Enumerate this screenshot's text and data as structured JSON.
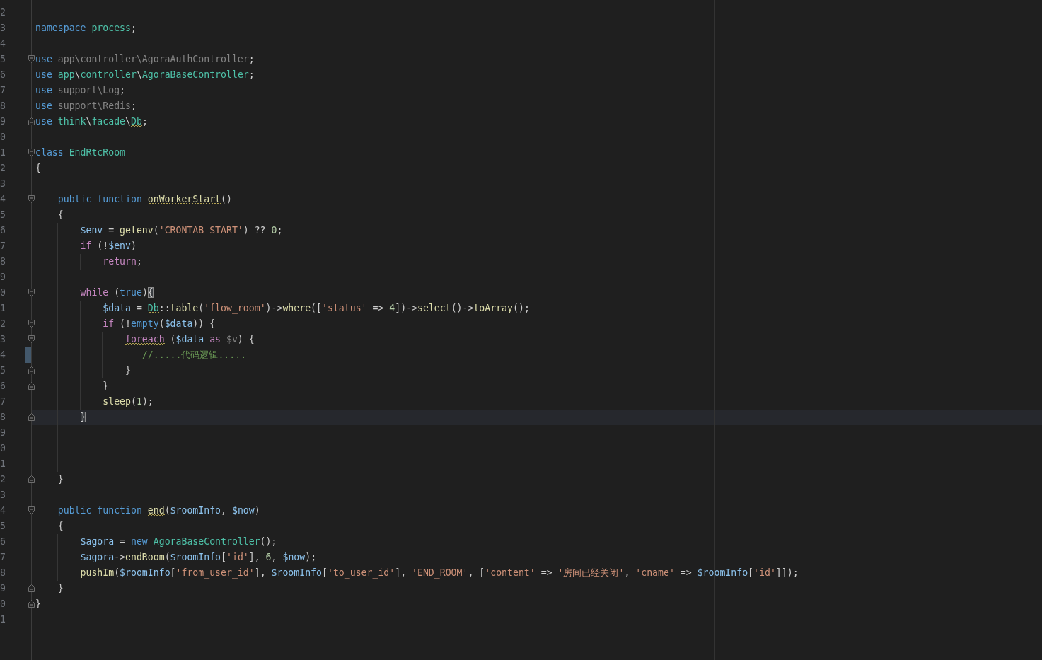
{
  "editor": {
    "lines": [
      {
        "number": "2",
        "current": false,
        "changed": false,
        "fold_start": false,
        "fold_end": false
      },
      {
        "number": "3",
        "current": false,
        "changed": false,
        "fold_start": false,
        "fold_end": false,
        "tokens": [
          {
            "text": "namespace ",
            "kind": "keyword",
            "warning": false,
            "matched": false
          },
          {
            "text": "process",
            "kind": "class",
            "warning": false,
            "matched": false
          },
          {
            "text": ";",
            "kind": "plain",
            "warning": false,
            "matched": false
          }
        ]
      },
      {
        "number": "4",
        "current": false,
        "changed": false,
        "fold_start": false,
        "fold_end": false
      },
      {
        "number": "5",
        "current": false,
        "changed": false,
        "fold_start": true,
        "fold_end": false,
        "tokens": [
          {
            "text": "use ",
            "kind": "keyword",
            "warning": false,
            "matched": false
          },
          {
            "text": "app\\controller\\AgoraAuthController",
            "kind": "unused",
            "warning": false,
            "matched": false
          },
          {
            "text": ";",
            "kind": "plain",
            "warning": false,
            "matched": false
          }
        ]
      },
      {
        "number": "6",
        "current": false,
        "changed": false,
        "fold_start": false,
        "fold_end": false,
        "tokens": [
          {
            "text": "use ",
            "kind": "keyword",
            "warning": false,
            "matched": false
          },
          {
            "text": "app",
            "kind": "class",
            "warning": false,
            "matched": false
          },
          {
            "text": "\\",
            "kind": "plain",
            "warning": false,
            "matched": false
          },
          {
            "text": "controller",
            "kind": "class",
            "warning": false,
            "matched": false
          },
          {
            "text": "\\",
            "kind": "plain",
            "warning": false,
            "matched": false
          },
          {
            "text": "AgoraBaseController",
            "kind": "class",
            "warning": false,
            "matched": false
          },
          {
            "text": ";",
            "kind": "plain",
            "warning": false,
            "matched": false
          }
        ]
      },
      {
        "number": "7",
        "current": false,
        "changed": false,
        "fold_start": false,
        "fold_end": false,
        "tokens": [
          {
            "text": "use ",
            "kind": "keyword",
            "warning": false,
            "matched": false
          },
          {
            "text": "support\\Log",
            "kind": "unused",
            "warning": false,
            "matched": false
          },
          {
            "text": ";",
            "kind": "plain",
            "warning": false,
            "matched": false
          }
        ]
      },
      {
        "number": "8",
        "current": false,
        "changed": false,
        "fold_start": false,
        "fold_end": false,
        "tokens": [
          {
            "text": "use ",
            "kind": "keyword",
            "warning": false,
            "matched": false
          },
          {
            "text": "support\\Redis",
            "kind": "unused",
            "warning": false,
            "matched": false
          },
          {
            "text": ";",
            "kind": "plain",
            "warning": false,
            "matched": false
          }
        ]
      },
      {
        "number": "9",
        "current": false,
        "changed": false,
        "fold_start": false,
        "fold_end": true,
        "tokens": [
          {
            "text": "use ",
            "kind": "keyword",
            "warning": false,
            "matched": false
          },
          {
            "text": "think",
            "kind": "class",
            "warning": false,
            "matched": false
          },
          {
            "text": "\\",
            "kind": "plain",
            "warning": false,
            "matched": false
          },
          {
            "text": "facade",
            "kind": "class",
            "warning": false,
            "matched": false
          },
          {
            "text": "\\",
            "kind": "plain",
            "warning": false,
            "matched": false
          },
          {
            "text": "Db",
            "kind": "class",
            "warning": true,
            "matched": false
          },
          {
            "text": ";",
            "kind": "plain",
            "warning": false,
            "matched": false
          }
        ]
      },
      {
        "number": "0",
        "current": false,
        "changed": false,
        "fold_start": false,
        "fold_end": false
      },
      {
        "number": "1",
        "current": false,
        "changed": false,
        "fold_start": true,
        "fold_end": false,
        "tokens": [
          {
            "text": "class ",
            "kind": "keyword",
            "warning": false,
            "matched": false
          },
          {
            "text": "EndRtcRoom",
            "kind": "class",
            "warning": false,
            "matched": false
          }
        ]
      },
      {
        "number": "2",
        "current": false,
        "changed": false,
        "fold_start": false,
        "fold_end": false,
        "tokens": [
          {
            "text": "{",
            "kind": "plain",
            "warning": false,
            "matched": false
          }
        ],
        "children": [
          {
            "number": "3",
            "current": false,
            "changed": false,
            "fold_start": false,
            "fold_end": false
          },
          {
            "number": "4",
            "current": false,
            "changed": false,
            "fold_start": true,
            "fold_end": false,
            "tokens": [
              {
                "text": "public function ",
                "kind": "keyword",
                "warning": false,
                "matched": false
              },
              {
                "text": "onWorkerStart",
                "kind": "function",
                "warning": true,
                "matched": false
              },
              {
                "text": "()",
                "kind": "plain",
                "warning": false,
                "matched": false
              }
            ]
          },
          {
            "number": "5",
            "current": false,
            "changed": false,
            "fold_start": false,
            "fold_end": false,
            "tokens": [
              {
                "text": "{",
                "kind": "plain",
                "warning": false,
                "matched": false
              }
            ],
            "children": [
              {
                "number": "6",
                "current": false,
                "changed": false,
                "fold_start": false,
                "fold_end": false,
                "tokens": [
                  {
                    "text": "$env",
                    "kind": "variable",
                    "warning": false,
                    "matched": false
                  },
                  {
                    "text": " = ",
                    "kind": "plain",
                    "warning": false,
                    "matched": false
                  },
                  {
                    "text": "getenv",
                    "kind": "function",
                    "warning": false,
                    "matched": false
                  },
                  {
                    "text": "(",
                    "kind": "plain",
                    "warning": false,
                    "matched": false
                  },
                  {
                    "text": "'CRONTAB_START'",
                    "kind": "string",
                    "warning": false,
                    "matched": false
                  },
                  {
                    "text": ") ?? ",
                    "kind": "plain",
                    "warning": false,
                    "matched": false
                  },
                  {
                    "text": "0",
                    "kind": "number",
                    "warning": false,
                    "matched": false
                  },
                  {
                    "text": ";",
                    "kind": "plain",
                    "warning": false,
                    "matched": false
                  }
                ]
              },
              {
                "number": "7",
                "current": false,
                "changed": false,
                "fold_start": false,
                "fold_end": false,
                "tokens": [
                  {
                    "text": "if",
                    "kind": "control",
                    "warning": false,
                    "matched": false
                  },
                  {
                    "text": " (!",
                    "kind": "plain",
                    "warning": false,
                    "matched": false
                  },
                  {
                    "text": "$env",
                    "kind": "variable",
                    "warning": false,
                    "matched": false
                  },
                  {
                    "text": ")",
                    "kind": "plain",
                    "warning": false,
                    "matched": false
                  }
                ],
                "children": [
                  {
                    "number": "8",
                    "current": false,
                    "changed": false,
                    "fold_start": false,
                    "fold_end": false,
                    "tokens": [
                      {
                        "text": "return",
                        "kind": "control",
                        "warning": false,
                        "matched": false
                      },
                      {
                        "text": ";",
                        "kind": "plain",
                        "warning": false,
                        "matched": false
                      }
                    ]
                  }
                ]
              },
              {
                "number": "9",
                "current": false,
                "changed": false,
                "fold_start": false,
                "fold_end": false
              },
              {
                "number": "0",
                "current": false,
                "changed": false,
                "fold_start": true,
                "fold_end": false,
                "tokens": [
                  {
                    "text": "while",
                    "kind": "control",
                    "warning": false,
                    "matched": false
                  },
                  {
                    "text": " (",
                    "kind": "plain",
                    "warning": false,
                    "matched": false
                  },
                  {
                    "text": "true",
                    "kind": "keyword",
                    "warning": false,
                    "matched": false
                  },
                  {
                    "text": ")",
                    "kind": "plain",
                    "warning": false,
                    "matched": false
                  },
                  {
                    "text": "{",
                    "kind": "plain",
                    "warning": false,
                    "matched": true
                  }
                ],
                "children": [
                  {
                    "number": "1",
                    "current": false,
                    "changed": false,
                    "fold_start": false,
                    "fold_end": false,
                    "tokens": [
                      {
                        "text": "$data",
                        "kind": "variable",
                        "warning": false,
                        "matched": false
                      },
                      {
                        "text": " = ",
                        "kind": "plain",
                        "warning": false,
                        "matched": false
                      },
                      {
                        "text": "Db",
                        "kind": "class",
                        "warning": true,
                        "matched": false
                      },
                      {
                        "text": "::",
                        "kind": "plain",
                        "warning": false,
                        "matched": false
                      },
                      {
                        "text": "table",
                        "kind": "function",
                        "warning": false,
                        "matched": false
                      },
                      {
                        "text": "(",
                        "kind": "plain",
                        "warning": false,
                        "matched": false
                      },
                      {
                        "text": "'flow_room'",
                        "kind": "string",
                        "warning": false,
                        "matched": false
                      },
                      {
                        "text": ")->",
                        "kind": "plain",
                        "warning": false,
                        "matched": false
                      },
                      {
                        "text": "where",
                        "kind": "function",
                        "warning": false,
                        "matched": false
                      },
                      {
                        "text": "([",
                        "kind": "plain",
                        "warning": false,
                        "matched": false
                      },
                      {
                        "text": "'status'",
                        "kind": "string",
                        "warning": false,
                        "matched": false
                      },
                      {
                        "text": " => ",
                        "kind": "plain",
                        "warning": false,
                        "matched": false
                      },
                      {
                        "text": "4",
                        "kind": "number",
                        "warning": false,
                        "matched": false
                      },
                      {
                        "text": "])->",
                        "kind": "plain",
                        "warning": false,
                        "matched": false
                      },
                      {
                        "text": "select",
                        "kind": "function",
                        "warning": false,
                        "matched": false
                      },
                      {
                        "text": "()->",
                        "kind": "plain",
                        "warning": false,
                        "matched": false
                      },
                      {
                        "text": "toArray",
                        "kind": "function",
                        "warning": false,
                        "matched": false
                      },
                      {
                        "text": "();",
                        "kind": "plain",
                        "warning": false,
                        "matched": false
                      }
                    ]
                  },
                  {
                    "number": "2",
                    "current": false,
                    "changed": false,
                    "fold_start": true,
                    "fold_end": false,
                    "tokens": [
                      {
                        "text": "if",
                        "kind": "control",
                        "warning": false,
                        "matched": false
                      },
                      {
                        "text": " (!",
                        "kind": "plain",
                        "warning": false,
                        "matched": false
                      },
                      {
                        "text": "empty",
                        "kind": "keyword",
                        "warning": false,
                        "matched": false
                      },
                      {
                        "text": "(",
                        "kind": "plain",
                        "warning": false,
                        "matched": false
                      },
                      {
                        "text": "$data",
                        "kind": "variable",
                        "warning": false,
                        "matched": false
                      },
                      {
                        "text": ")) {",
                        "kind": "plain",
                        "warning": false,
                        "matched": false
                      }
                    ],
                    "children": [
                      {
                        "number": "3",
                        "current": false,
                        "changed": false,
                        "fold_start": true,
                        "fold_end": false,
                        "tokens": [
                          {
                            "text": "foreach",
                            "kind": "control",
                            "warning": true,
                            "matched": false
                          },
                          {
                            "text": " (",
                            "kind": "plain",
                            "warning": false,
                            "matched": false
                          },
                          {
                            "text": "$data",
                            "kind": "variable",
                            "warning": false,
                            "matched": false
                          },
                          {
                            "text": " as ",
                            "kind": "control",
                            "warning": false,
                            "matched": false
                          },
                          {
                            "text": "$v",
                            "kind": "unused",
                            "warning": false,
                            "matched": false
                          },
                          {
                            "text": ") {",
                            "kind": "plain",
                            "warning": false,
                            "matched": false
                          }
                        ]
                      },
                      {
                        "number": "4",
                        "current": false,
                        "changed": true,
                        "fold_start": false,
                        "fold_end": false,
                        "tokens": [
                          {
                            "text": "   //.....代码逻辑.....",
                            "kind": "comment",
                            "warning": false,
                            "matched": false
                          }
                        ]
                      },
                      {
                        "number": "5",
                        "current": false,
                        "changed": false,
                        "fold_start": false,
                        "fold_end": true,
                        "tokens": [
                          {
                            "text": "}",
                            "kind": "plain",
                            "warning": false,
                            "matched": false
                          }
                        ]
                      }
                    ]
                  },
                  {
                    "number": "6",
                    "current": false,
                    "changed": false,
                    "fold_start": false,
                    "fold_end": true,
                    "tokens": [
                      {
                        "text": "}",
                        "kind": "plain",
                        "warning": false,
                        "matched": false
                      }
                    ]
                  },
                  {
                    "number": "7",
                    "current": false,
                    "changed": false,
                    "fold_start": false,
                    "fold_end": false,
                    "tokens": [
                      {
                        "text": "sleep",
                        "kind": "function",
                        "warning": false,
                        "matched": false
                      },
                      {
                        "text": "(",
                        "kind": "plain",
                        "warning": false,
                        "matched": false
                      },
                      {
                        "text": "1",
                        "kind": "number",
                        "warning": false,
                        "matched": false
                      },
                      {
                        "text": ");",
                        "kind": "plain",
                        "warning": false,
                        "matched": false
                      }
                    ]
                  }
                ]
              },
              {
                "number": "8",
                "current": true,
                "changed": false,
                "fold_start": false,
                "fold_end": true,
                "tokens": [
                  {
                    "text": "}",
                    "kind": "plain",
                    "warning": false,
                    "matched": true
                  }
                ]
              },
              {
                "number": "9",
                "current": false,
                "changed": false,
                "fold_start": false,
                "fold_end": false
              },
              {
                "number": "0",
                "current": false,
                "changed": false,
                "fold_start": false,
                "fold_end": false
              },
              {
                "number": "1",
                "current": false,
                "changed": false,
                "fold_start": false,
                "fold_end": false
              }
            ]
          },
          {
            "number": "2",
            "current": false,
            "changed": false,
            "fold_start": false,
            "fold_end": true,
            "tokens": [
              {
                "text": "}",
                "kind": "plain",
                "warning": false,
                "matched": false
              }
            ]
          },
          {
            "number": "3",
            "current": false,
            "changed": false,
            "fold_start": false,
            "fold_end": false
          },
          {
            "number": "4",
            "current": false,
            "changed": false,
            "fold_start": true,
            "fold_end": false,
            "tokens": [
              {
                "text": "public function ",
                "kind": "keyword",
                "warning": false,
                "matched": false
              },
              {
                "text": "end",
                "kind": "function",
                "warning": true,
                "matched": false
              },
              {
                "text": "(",
                "kind": "plain",
                "warning": false,
                "matched": false
              },
              {
                "text": "$roomInfo",
                "kind": "variable",
                "warning": false,
                "matched": false
              },
              {
                "text": ", ",
                "kind": "plain",
                "warning": false,
                "matched": false
              },
              {
                "text": "$now",
                "kind": "variable",
                "warning": false,
                "matched": false
              },
              {
                "text": ")",
                "kind": "plain",
                "warning": false,
                "matched": false
              }
            ]
          },
          {
            "number": "5",
            "current": false,
            "changed": false,
            "fold_start": false,
            "fold_end": false,
            "tokens": [
              {
                "text": "{",
                "kind": "plain",
                "warning": false,
                "matched": false
              }
            ],
            "children": [
              {
                "number": "6",
                "current": false,
                "changed": false,
                "fold_start": false,
                "fold_end": false,
                "tokens": [
                  {
                    "text": "$agora",
                    "kind": "variable",
                    "warning": false,
                    "matched": false
                  },
                  {
                    "text": " = ",
                    "kind": "plain",
                    "warning": false,
                    "matched": false
                  },
                  {
                    "text": "new ",
                    "kind": "keyword",
                    "warning": false,
                    "matched": false
                  },
                  {
                    "text": "AgoraBaseController",
                    "kind": "class",
                    "warning": false,
                    "matched": false
                  },
                  {
                    "text": "();",
                    "kind": "plain",
                    "warning": false,
                    "matched": false
                  }
                ]
              },
              {
                "number": "7",
                "current": false,
                "changed": false,
                "fold_start": false,
                "fold_end": false,
                "tokens": [
                  {
                    "text": "$agora",
                    "kind": "variable",
                    "warning": false,
                    "matched": false
                  },
                  {
                    "text": "->",
                    "kind": "plain",
                    "warning": false,
                    "matched": false
                  },
                  {
                    "text": "endRoom",
                    "kind": "function",
                    "warning": false,
                    "matched": false
                  },
                  {
                    "text": "(",
                    "kind": "plain",
                    "warning": false,
                    "matched": false
                  },
                  {
                    "text": "$roomInfo",
                    "kind": "variable",
                    "warning": false,
                    "matched": false
                  },
                  {
                    "text": "[",
                    "kind": "plain",
                    "warning": false,
                    "matched": false
                  },
                  {
                    "text": "'id'",
                    "kind": "string",
                    "warning": false,
                    "matched": false
                  },
                  {
                    "text": "], ",
                    "kind": "plain",
                    "warning": false,
                    "matched": false
                  },
                  {
                    "text": "6",
                    "kind": "number",
                    "warning": false,
                    "matched": false
                  },
                  {
                    "text": ", ",
                    "kind": "plain",
                    "warning": false,
                    "matched": false
                  },
                  {
                    "text": "$now",
                    "kind": "variable",
                    "warning": false,
                    "matched": false
                  },
                  {
                    "text": ");",
                    "kind": "plain",
                    "warning": false,
                    "matched": false
                  }
                ]
              },
              {
                "number": "8",
                "current": false,
                "changed": false,
                "fold_start": false,
                "fold_end": false,
                "tokens": [
                  {
                    "text": "pushIm",
                    "kind": "function",
                    "warning": false,
                    "matched": false
                  },
                  {
                    "text": "(",
                    "kind": "plain",
                    "warning": false,
                    "matched": false
                  },
                  {
                    "text": "$roomInfo",
                    "kind": "variable",
                    "warning": false,
                    "matched": false
                  },
                  {
                    "text": "[",
                    "kind": "plain",
                    "warning": false,
                    "matched": false
                  },
                  {
                    "text": "'from_user_id'",
                    "kind": "string",
                    "warning": false,
                    "matched": false
                  },
                  {
                    "text": "], ",
                    "kind": "plain",
                    "warning": false,
                    "matched": false
                  },
                  {
                    "text": "$roomInfo",
                    "kind": "variable",
                    "warning": false,
                    "matched": false
                  },
                  {
                    "text": "[",
                    "kind": "plain",
                    "warning": false,
                    "matched": false
                  },
                  {
                    "text": "'to_user_id'",
                    "kind": "string",
                    "warning": false,
                    "matched": false
                  },
                  {
                    "text": "], ",
                    "kind": "plain",
                    "warning": false,
                    "matched": false
                  },
                  {
                    "text": "'END_ROOM'",
                    "kind": "string",
                    "warning": false,
                    "matched": false
                  },
                  {
                    "text": ", [",
                    "kind": "plain",
                    "warning": false,
                    "matched": false
                  },
                  {
                    "text": "'content'",
                    "kind": "string",
                    "warning": false,
                    "matched": false
                  },
                  {
                    "text": " => ",
                    "kind": "plain",
                    "warning": false,
                    "matched": false
                  },
                  {
                    "text": "'房间已经关闭'",
                    "kind": "string",
                    "warning": false,
                    "matched": false
                  },
                  {
                    "text": ", ",
                    "kind": "plain",
                    "warning": false,
                    "matched": false
                  },
                  {
                    "text": "'cname'",
                    "kind": "string",
                    "warning": false,
                    "matched": false
                  },
                  {
                    "text": " => ",
                    "kind": "plain",
                    "warning": false,
                    "matched": false
                  },
                  {
                    "text": "$roomInfo",
                    "kind": "variable",
                    "warning": false,
                    "matched": false
                  },
                  {
                    "text": "[",
                    "kind": "plain",
                    "warning": false,
                    "matched": false
                  },
                  {
                    "text": "'id'",
                    "kind": "string",
                    "warning": false,
                    "matched": false
                  },
                  {
                    "text": "]]);",
                    "kind": "plain",
                    "warning": false,
                    "matched": false
                  }
                ]
              }
            ]
          },
          {
            "number": "9",
            "current": false,
            "changed": false,
            "fold_start": false,
            "fold_end": true,
            "tokens": [
              {
                "text": "}",
                "kind": "plain",
                "warning": false,
                "matched": false
              }
            ]
          }
        ]
      },
      {
        "number": "0",
        "current": false,
        "changed": false,
        "fold_start": false,
        "fold_end": true,
        "tokens": [
          {
            "text": "}",
            "kind": "plain",
            "warning": false,
            "matched": false
          }
        ]
      },
      {
        "number": "1",
        "current": false,
        "changed": false,
        "fold_start": false,
        "fold_end": false
      }
    ]
  }
}
